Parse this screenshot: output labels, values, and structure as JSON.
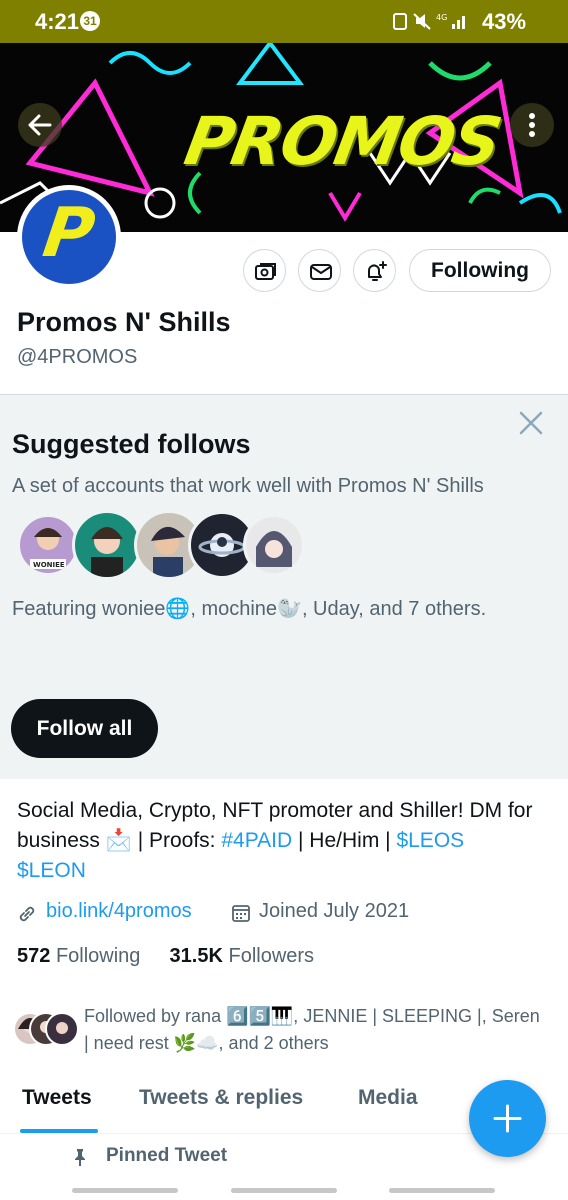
{
  "status_bar": {
    "time": "4:21",
    "notification_count": "31",
    "network": "4G",
    "battery": "43%",
    "bg_color": "#808000"
  },
  "header": {
    "banner_text": "PROMOS",
    "back_icon": "arrow-left-icon",
    "more_icon": "more-vertical-icon"
  },
  "profile": {
    "avatar_letter": "P",
    "name": "Promos N' Shills",
    "handle": "@4PROMOS",
    "following_label": "Following",
    "icons": [
      "subscribe-icon",
      "message-icon",
      "notifications-icon"
    ]
  },
  "suggested": {
    "title": "Suggested follows",
    "subtitle": "A set of accounts that work well with Promos N' Shills",
    "featuring": "Featuring woniee🌐, mochine🦭, Uday, and 7 others.",
    "follow_all_label": "Follow all",
    "avatar_badge": "WONIEE"
  },
  "bio": {
    "line_start": "Social Media, Crypto, NFT promoter and Shiller! DM for business 📩 | Proofs: ",
    "hashtag": "#4PAID",
    "middle": " | He/Him | ",
    "cashtag1": "$LEOS",
    "cashtag2": "$LEON"
  },
  "meta": {
    "link": "bio.link/4promos",
    "joined": "Joined July 2021"
  },
  "counts": {
    "following_count": "572",
    "following_label": "Following",
    "followers_count": "31.5K",
    "followers_label": "Followers"
  },
  "followed_by": {
    "text": "Followed by rana 6️⃣5️⃣🎹, JENNIE | SLEEPING |, Seren | need rest 🌿☁️, and 2 others"
  },
  "tabs": [
    {
      "label": "Tweets",
      "active": true
    },
    {
      "label": "Tweets & replies",
      "active": false
    },
    {
      "label": "Media",
      "active": false
    }
  ],
  "pinned": {
    "label": "Pinned Tweet"
  },
  "colors": {
    "accent": "#1d9bf0",
    "text": "#0f1419",
    "secondary": "#536471",
    "banner_yellow": "#e8f51a"
  }
}
